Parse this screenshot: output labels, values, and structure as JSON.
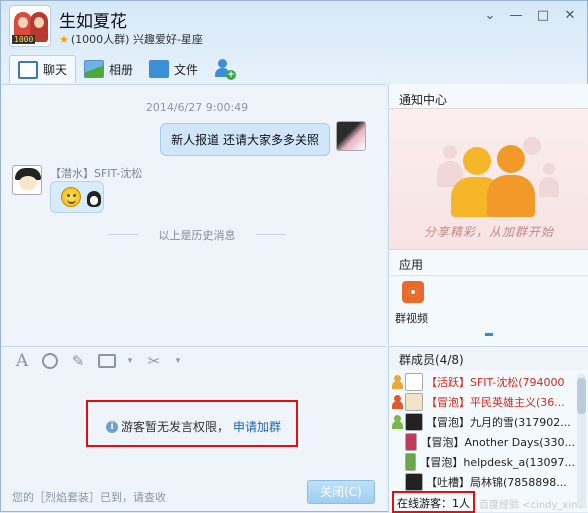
{
  "window": {
    "group_name": "生如夏花",
    "group_sub": "(1000人群) 兴趣爱好-星座",
    "avatar_badge": "1000"
  },
  "tabs": [
    {
      "label": "聊天",
      "icon": "chat-icon"
    },
    {
      "label": "相册",
      "icon": "photo-icon"
    },
    {
      "label": "文件",
      "icon": "folder-icon"
    },
    {
      "label": "",
      "icon": "add-member-icon"
    }
  ],
  "chat": {
    "timestamp": "2014/6/27  9:00:49",
    "my_message": "新人报道 还请大家多多关照",
    "sender": "【潜水】SFIT-沈松",
    "history_label": "以上是历史消息"
  },
  "input": {
    "notice": "游客暂无发言权限，",
    "join_link": "申请加群",
    "status": "您的［烈焰套装］已到，请查收",
    "close_button": "关闭(C)"
  },
  "right_panel": {
    "notice_title": "通知中心",
    "share_text": "分享精彩，从加群开始",
    "apps_title": "应用",
    "app_label": "群视频",
    "members_title": "群成员(4/8)",
    "members": [
      {
        "text": "【活跃】SFIT-沈松(794000",
        "color": "#d42a1a",
        "role_color": "#e6a93a"
      },
      {
        "text": "【冒泡】平民英雄主义(36...",
        "color": "#d42a1a",
        "role_color": "#e05a2a"
      },
      {
        "text": "【冒泡】九月的雪(317902...",
        "color": "#111111",
        "role_color": "#7ab84a"
      },
      {
        "text": "【冒泡】Another Days(330...",
        "color": "#111111",
        "role_color": ""
      },
      {
        "text": "【冒泡】helpdesk_a(13097...",
        "color": "#111111",
        "role_color": ""
      },
      {
        "text": "【吐槽】局林锦(7858898...",
        "color": "#111111",
        "role_color": ""
      }
    ],
    "guest_count": "在线游客：1人",
    "watermark": "百度经验 <cindy_xin..."
  },
  "colors": {
    "accent": "#3b86d0",
    "red_box": "#e01010",
    "link": "#1a67b3"
  }
}
